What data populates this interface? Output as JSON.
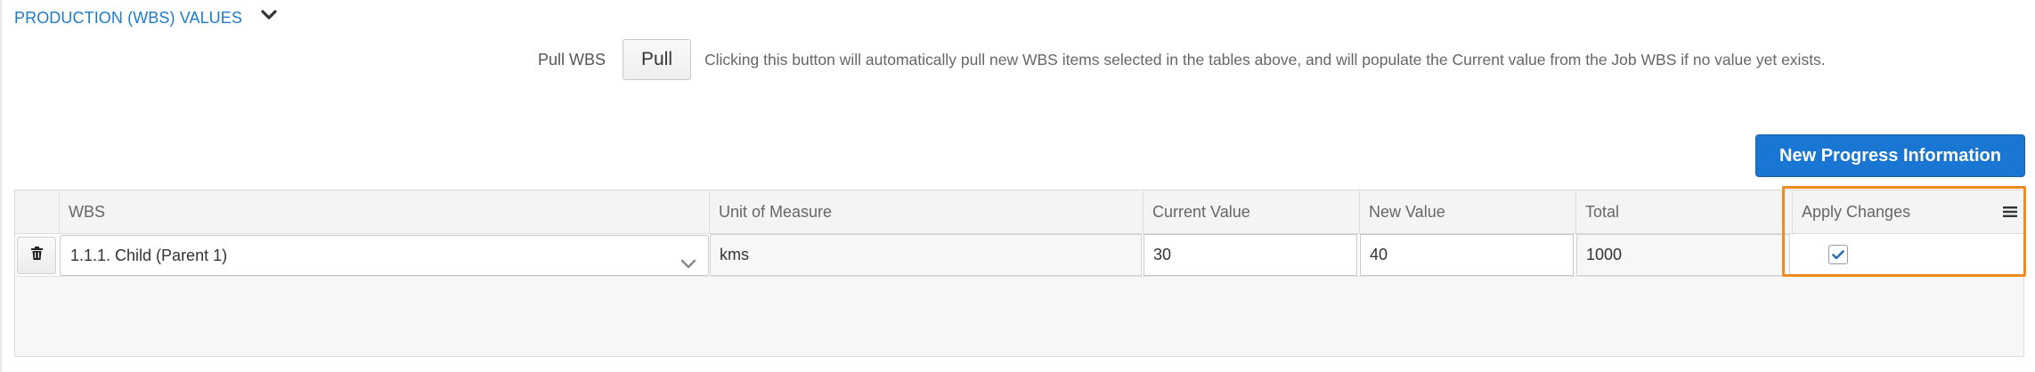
{
  "section": {
    "title": "PRODUCTION (WBS) VALUES",
    "toggle_icon": "chevron-down-icon"
  },
  "pull": {
    "label": "Pull WBS",
    "button_label": "Pull",
    "help_text": "Clicking this button will automatically pull new WBS items selected in the tables above, and will populate the Current value from the Job WBS if no value yet exists."
  },
  "new_progress_button": "New Progress Information",
  "grid": {
    "columns": [
      "WBS",
      "Unit of Measure",
      "Current Value",
      "New Value",
      "Total",
      "Apply Changes"
    ],
    "menu_icon": "hamburger-menu-icon",
    "rows": [
      {
        "delete_icon": "trash-icon",
        "wbs": "1.1.1. Child (Parent 1)",
        "unit_of_measure": "kms",
        "current_value": "30",
        "new_value": "40",
        "total": "1000",
        "apply_changes": true
      }
    ]
  },
  "colors": {
    "link_blue": "#1e7bc8",
    "primary_button": "#1976d2",
    "highlight_orange": "#f0891e",
    "checkmark": "#2a6db5"
  }
}
